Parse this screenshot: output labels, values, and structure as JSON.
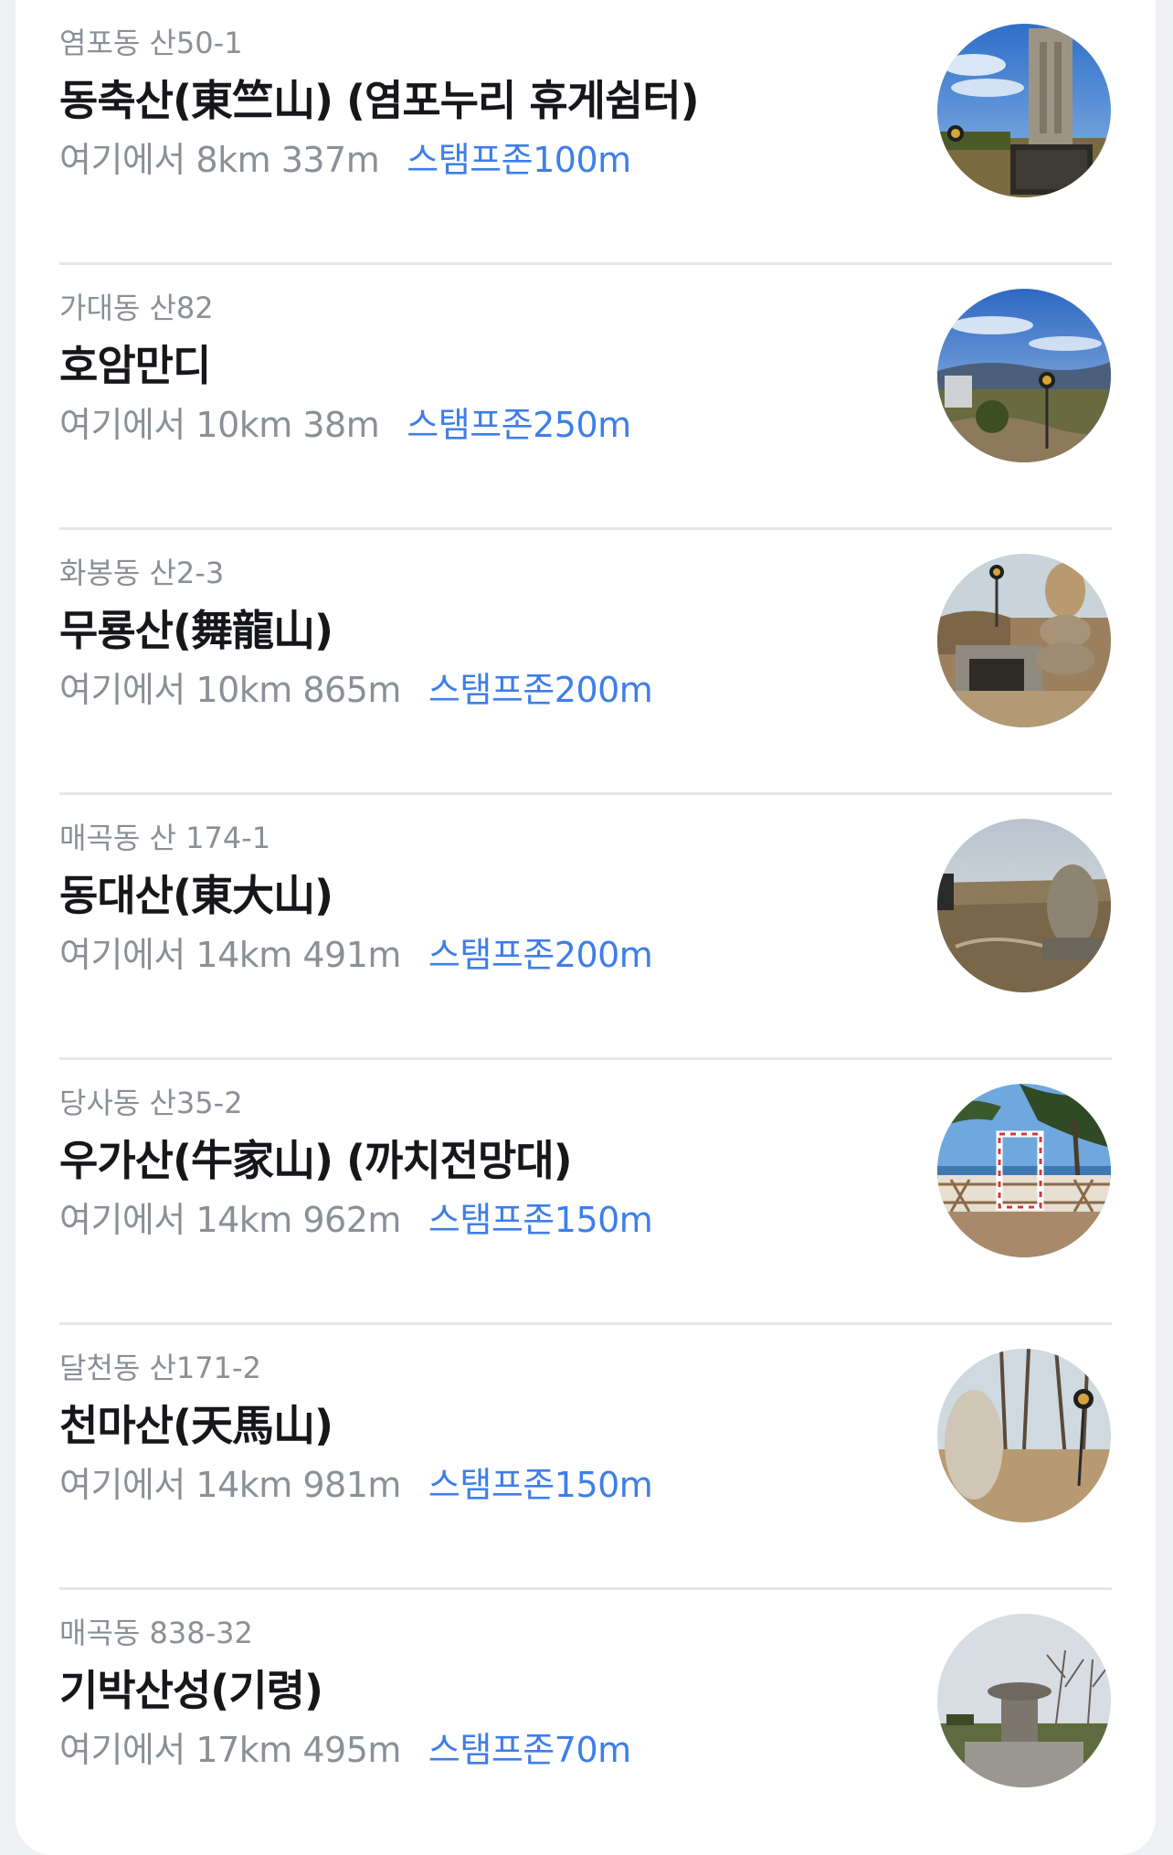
{
  "items": [
    {
      "address": "염포동 산50-1",
      "name": "동축산(東竺山) (염포누리 휴게쉼터)",
      "distance": "여기에서 8km 337m",
      "stamp_zone": "스탬프존100m",
      "image_icon": "summit-monument-photo"
    },
    {
      "address": "가대동 산82",
      "name": "호암만디",
      "distance": "여기에서 10km 38m",
      "stamp_zone": "스탬프존250m",
      "image_icon": "mountain-view-photo"
    },
    {
      "address": "화봉동 산2-3",
      "name": "무룡산(舞龍山)",
      "distance": "여기에서 10km 865m",
      "stamp_zone": "스탬프존200m",
      "image_icon": "summit-stone-photo"
    },
    {
      "address": "매곡동 산 174-1",
      "name": "동대산(東大山)",
      "distance": "여기에서 14km 491m",
      "stamp_zone": "스탬프존200m",
      "image_icon": "summit-field-photo"
    },
    {
      "address": "당사동 산35-2",
      "name": "우가산(牛家山) (까치전망대)",
      "distance": "여기에서 14km 962m",
      "stamp_zone": "스탬프존150m",
      "image_icon": "observatory-deck-photo"
    },
    {
      "address": "달천동 산171-2",
      "name": "천마산(天馬山)",
      "distance": "여기에서 14km 981m",
      "stamp_zone": "스탬프존150m",
      "image_icon": "summit-marker-photo"
    },
    {
      "address": "매곡동 838-32",
      "name": "기박산성(기령)",
      "distance": "여기에서 17km 495m",
      "stamp_zone": "스탬프존70m",
      "image_icon": "fortress-ruins-photo"
    }
  ],
  "colors": {
    "accent": "#3f7ee8",
    "muted": "#8b8f96",
    "title": "#16171a"
  }
}
